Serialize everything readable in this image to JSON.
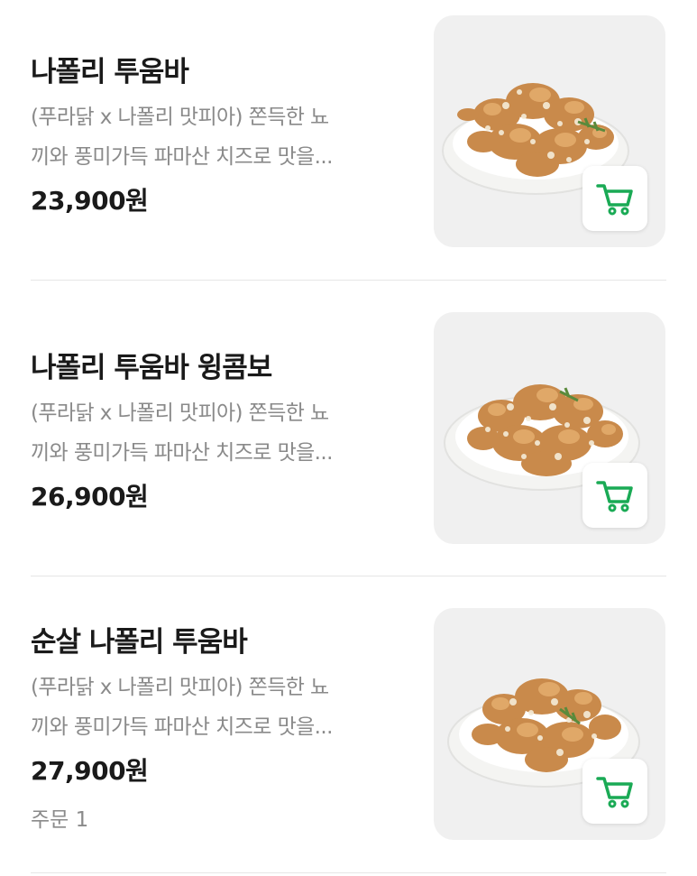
{
  "menu": {
    "items": [
      {
        "name": "나폴리 투움바",
        "description": "(푸라닭 x 나폴리 맛피아) 쫀득한 뇨\n끼와 풍미가득 파마산 치즈로 맛을...",
        "price": "23,900원",
        "cart_icon": "cart-icon"
      },
      {
        "name": "나폴리 투움바 윙콤보",
        "description": "(푸라닭 x 나폴리 맛피아) 쫀득한 뇨\n끼와 풍미가득 파마산 치즈로 맛을...",
        "price": "26,900원",
        "cart_icon": "cart-icon"
      },
      {
        "name": "순살 나폴리 투움바",
        "description": "(푸라닭 x 나폴리 맛피아) 쫀득한 뇨\n끼와 풍미가득 파마산 치즈로 맛을...",
        "price": "27,900원",
        "order_count": "주문 1",
        "cart_icon": "cart-icon"
      }
    ]
  },
  "colors": {
    "accent": "#1aaa55",
    "description_text": "#8a8a8a",
    "thumbnail_bg": "#f0f0f0",
    "divider": "#e6e6e6"
  }
}
